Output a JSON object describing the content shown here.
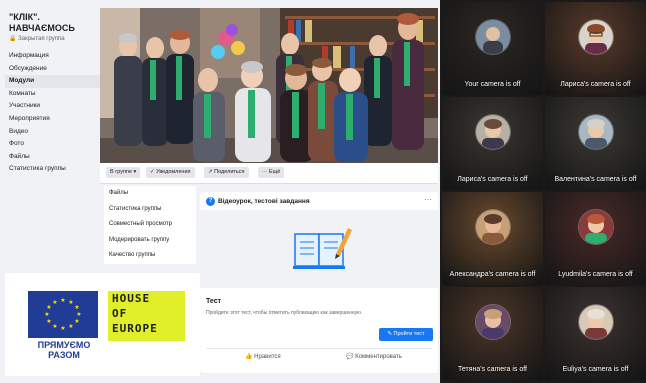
{
  "group": {
    "name": "\"КЛІК\". НАВЧАЄМОСЬ",
    "type": "Закрытая группа"
  },
  "sidebar": {
    "items": [
      {
        "label": "Информация"
      },
      {
        "label": "Обсуждение"
      },
      {
        "label": "Модули"
      },
      {
        "label": "Комнаты"
      },
      {
        "label": "Участники"
      },
      {
        "label": "Мероприятия"
      },
      {
        "label": "Видео"
      },
      {
        "label": "Фото"
      },
      {
        "label": "Файлы"
      },
      {
        "label": "Статистика группы"
      }
    ]
  },
  "group_actions": {
    "in_group": "В группе ▾",
    "notifications": "✓ Уведомления",
    "share": "↗ Поделиться",
    "more": "··· Ещё"
  },
  "dropdown": {
    "items": [
      {
        "label": "Файлы"
      },
      {
        "label": "Статистика группы"
      },
      {
        "label": "Совместный просмотр"
      },
      {
        "label": "Модерировать группу"
      },
      {
        "label": "Качество группы"
      }
    ]
  },
  "post": {
    "header": "Відеоурок, тестові завдання",
    "badge": "?",
    "more": "···",
    "test_title": "Тест",
    "test_desc": "Пройдите этот тест, чтобы отметить публикацию как завершенную.",
    "open_button": "Пройти тест",
    "like": "Нравится",
    "comment": "Комментировать"
  },
  "logos": {
    "eu_line1": "ПРЯМУЄМО",
    "eu_line2": "РАЗОМ",
    "hoe_rows": [
      "HOUSE",
      "OF",
      "EUROPE"
    ]
  },
  "call": {
    "tiles": [
      {
        "label": "Your camera is off",
        "avatar": "avatar-1",
        "bg": "#2b2724"
      },
      {
        "label": "Лариса's camera is off",
        "avatar": "avatar-2",
        "bg": "#5a3a2a"
      },
      {
        "label": "Лариса's camera is off",
        "avatar": "avatar-3",
        "bg": "#3a3632"
      },
      {
        "label": "Валентина's camera is off",
        "avatar": "avatar-4",
        "bg": "#3c3a36"
      },
      {
        "label": "Александра's camera is off",
        "avatar": "avatar-5",
        "bg": "#6a4a2e"
      },
      {
        "label": "Lyudmila's camera is off",
        "avatar": "avatar-6",
        "bg": "#4a2a28"
      },
      {
        "label": "Тетяна's camera is off",
        "avatar": "avatar-7",
        "bg": "#4c3628"
      },
      {
        "label": "Euliya's camera is off",
        "avatar": "avatar-8",
        "bg": "#3c3230"
      }
    ]
  }
}
